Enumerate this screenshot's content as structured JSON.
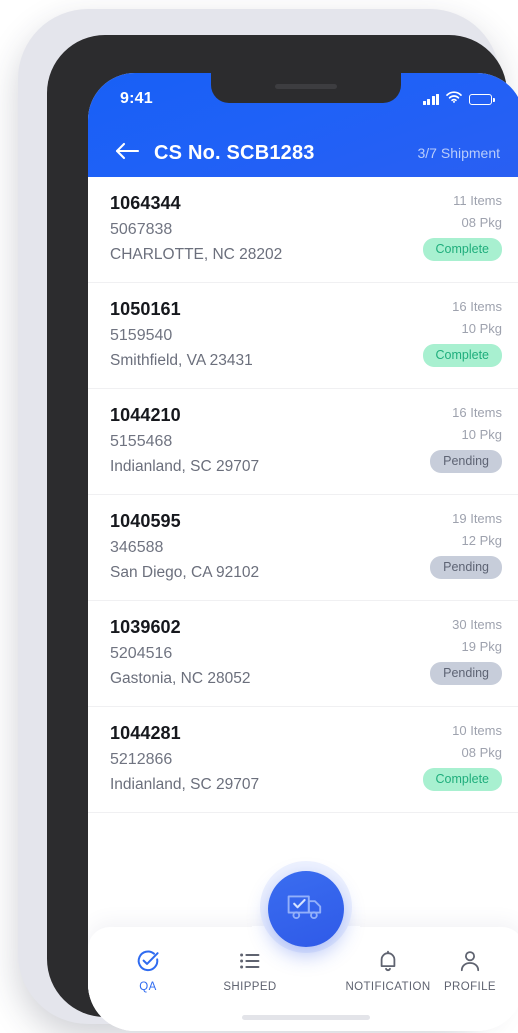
{
  "status_bar": {
    "time": "9:41",
    "signal_icon": "signal-bars-icon",
    "wifi_icon": "wifi-icon",
    "battery_icon": "battery-icon"
  },
  "header": {
    "back_icon": "arrow-left-icon",
    "title": "CS No. SCB1283",
    "counter": "3/7 Shipment",
    "background_color": "#1f61f7",
    "counter_color": "#b9cdfb"
  },
  "shipments": [
    {
      "id": "1064344",
      "reference": "5067838",
      "address": "CHARLOTTE, NC  28202",
      "items": "11 Items",
      "packages": "08 Pkg",
      "status": "Complete",
      "status_type": "complete"
    },
    {
      "id": "1050161",
      "reference": "5159540",
      "address": "Smithfield, VA 23431",
      "items": "16 Items",
      "packages": "10 Pkg",
      "status": "Complete",
      "status_type": "complete"
    },
    {
      "id": "1044210",
      "reference": "5155468",
      "address": "Indianland, SC 29707",
      "items": "16 Items",
      "packages": "10 Pkg",
      "status": "Pending",
      "status_type": "pending"
    },
    {
      "id": "1040595",
      "reference": "346588",
      "address": "San Diego, CA 92102",
      "items": "19 Items",
      "packages": "12 Pkg",
      "status": "Pending",
      "status_type": "pending"
    },
    {
      "id": "1039602",
      "reference": "5204516",
      "address": "Gastonia, NC 28052",
      "items": "30 Items",
      "packages": "19 Pkg",
      "status": "Pending",
      "status_type": "pending"
    },
    {
      "id": "1044281",
      "reference": "5212866",
      "address": "Indianland, SC 29707",
      "items": "10 Items",
      "packages": "08 Pkg",
      "status": "Complete",
      "status_type": "complete"
    }
  ],
  "fab": {
    "icon": "delivery-truck-check-icon"
  },
  "bottom_nav": {
    "items": [
      {
        "label": "QA",
        "icon": "check-circle-icon",
        "active": true
      },
      {
        "label": "SHIPPED",
        "icon": "list-icon",
        "active": false
      },
      {
        "label": "NOTIFICATION",
        "icon": "bell-icon",
        "active": false
      },
      {
        "label": "PROFILE",
        "icon": "person-icon",
        "active": false
      }
    ]
  },
  "colors": {
    "accent": "#2f6bf0",
    "badge_complete_bg": "#a8f0d0",
    "badge_complete_text": "#1fae7c",
    "badge_pending_bg": "#c7cdda",
    "badge_pending_text": "#5e6474"
  }
}
